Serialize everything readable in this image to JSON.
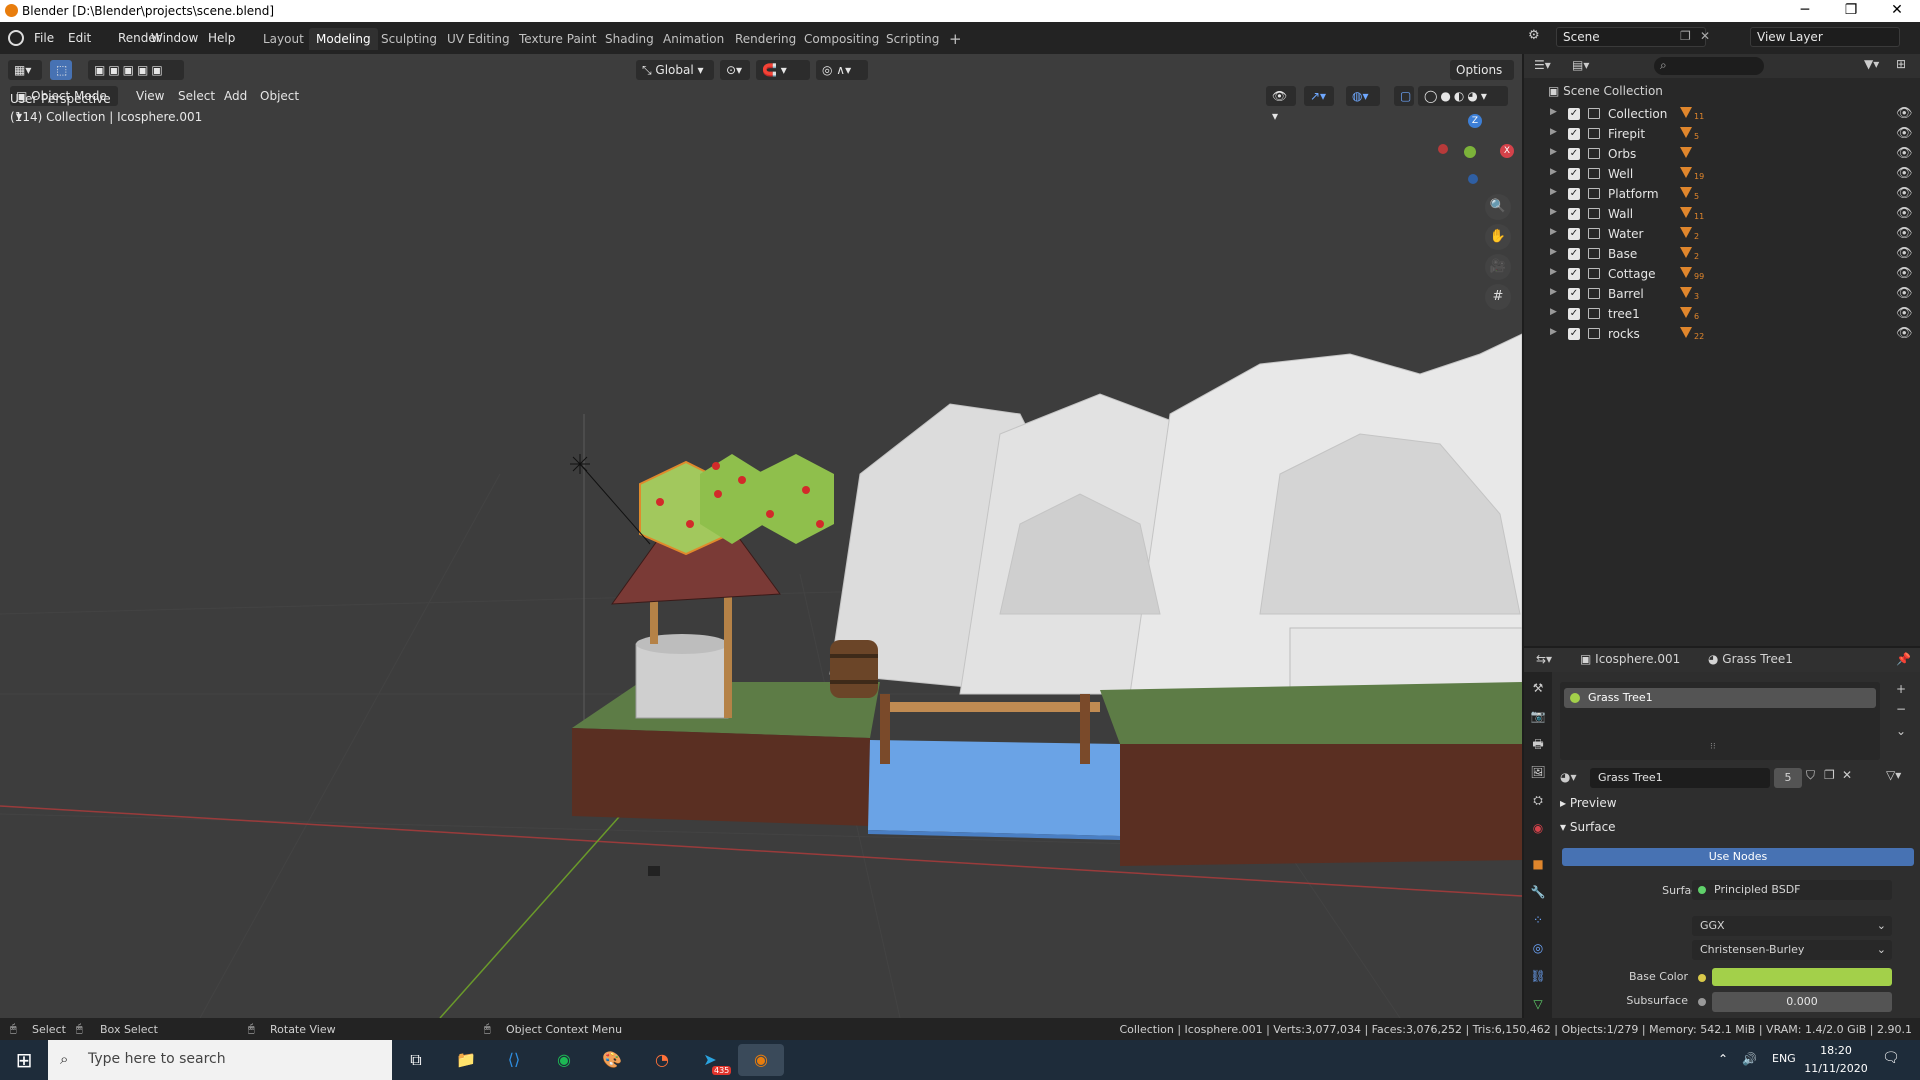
{
  "window": {
    "title": "Blender [D:\\Blender\\projects\\scene.blend]",
    "minimize": "─",
    "restore": "❐",
    "close": "✕"
  },
  "menubar": {
    "items": [
      "File",
      "Edit",
      "Render",
      "Window",
      "Help"
    ],
    "workspaces": [
      "Layout",
      "Modeling",
      "Sculpting",
      "UV Editing",
      "Texture Paint",
      "Shading",
      "Animation",
      "Rendering",
      "Compositing",
      "Scripting"
    ],
    "active_workspace": "Modeling",
    "add_workspace": "+",
    "scene_name": "Scene",
    "view_layer": "View Layer"
  },
  "viewport": {
    "mode": "Object Mode",
    "menus": [
      "View",
      "Select",
      "Add",
      "Object"
    ],
    "transform_orientation": "Global",
    "options_label": "Options",
    "perspective_label": "User Perspective",
    "context_label": "(114) Collection | Icosphere.001",
    "gizmo_axes": {
      "x": "X",
      "y": "Y",
      "z": "Z"
    }
  },
  "outliner": {
    "root": "Scene Collection",
    "collections": [
      {
        "name": "Collection",
        "badge": "11"
      },
      {
        "name": "Firepit",
        "badge": "5"
      },
      {
        "name": "Orbs",
        "badge": ""
      },
      {
        "name": "Well",
        "badge": "19"
      },
      {
        "name": "Platform",
        "badge": "5"
      },
      {
        "name": "Wall",
        "badge": "11"
      },
      {
        "name": "Water",
        "badge": "2"
      },
      {
        "name": "Base",
        "badge": "2"
      },
      {
        "name": "Cottage",
        "badge": "99"
      },
      {
        "name": "Barrel",
        "badge": "3"
      },
      {
        "name": "tree1",
        "badge": "6"
      },
      {
        "name": "rocks",
        "badge": "22"
      }
    ]
  },
  "properties": {
    "object_name": "Icosphere.001",
    "material_name": "Grass Tree1",
    "slot_label": "Grass Tree1",
    "material_field": "Grass Tree1",
    "user_count": "5",
    "preview_label": "Preview",
    "surface_section": "Surface",
    "use_nodes": "Use Nodes",
    "surface_label": "Surface",
    "surface_value": "Principled BSDF",
    "distribution": "GGX",
    "subsurface_method": "Christensen-Burley",
    "base_color_label": "Base Color",
    "base_color": "#a3d04a",
    "subsurface_label": "Subsurface",
    "subsurface_value": "0.000"
  },
  "statusbar": {
    "select": "Select",
    "box_select": "Box Select",
    "rotate_view": "Rotate View",
    "context_menu": "Object Context Menu",
    "stats": "Collection | Icosphere.001 | Verts:3,077,034 | Faces:3,076,252 | Tris:6,150,462 | Objects:1/279 | Memory: 542.1 MiB | VRAM: 1.4/2.0 GiB | 2.90.1"
  },
  "taskbar": {
    "search_placeholder": "Type here to search",
    "language": "ENG",
    "time": "18:20",
    "date": "11/11/2020",
    "telegram_badge": "435"
  },
  "colors": {
    "accent": "#4772b3",
    "grass_top": "#5b7a45",
    "dirt": "#5a2f22",
    "water": "#6aa3e6",
    "rocks": "#d9d9d9"
  }
}
